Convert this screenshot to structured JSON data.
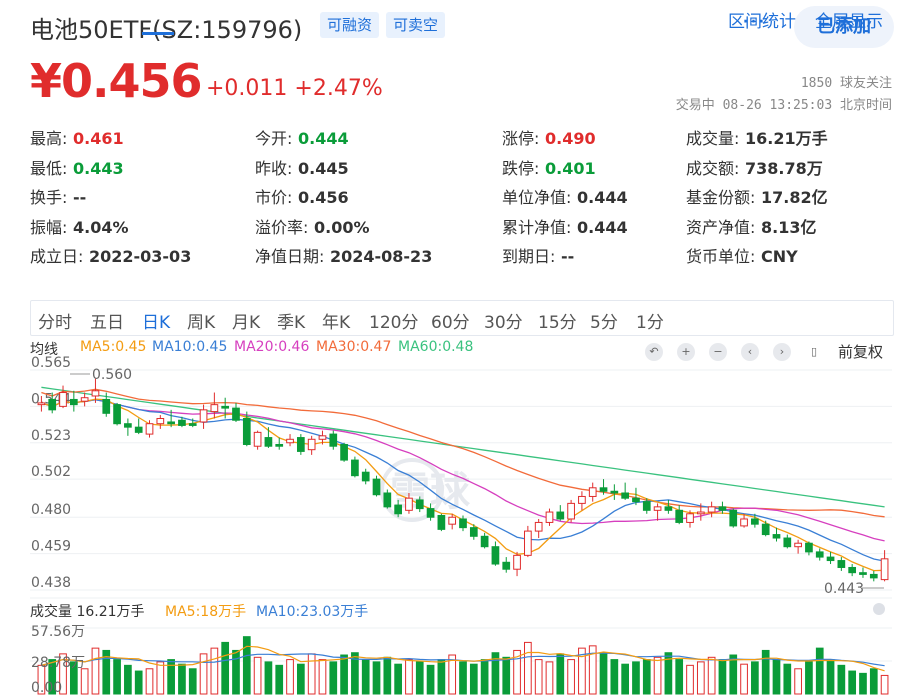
{
  "header": {
    "title": "电池50ETF(SZ:159796)",
    "tag1": "可融资",
    "tag2": "可卖空",
    "more": "···",
    "added": "已添加",
    "price": "¥0.456",
    "change": "+0.011 +2.47%",
    "followers": "1850 球友关注",
    "trade_time": "交易中 08-26 13:25:03 北京时间"
  },
  "quote": [
    [
      {
        "label": "最高:",
        "value": "0.461",
        "color": "red"
      },
      {
        "label": "今开:",
        "value": "0.444",
        "color": "green"
      },
      {
        "label": "涨停:",
        "value": "0.490",
        "color": "red"
      },
      {
        "label": "成交量:",
        "value": "16.21万手",
        "color": ""
      }
    ],
    [
      {
        "label": "最低:",
        "value": "0.443",
        "color": "green"
      },
      {
        "label": "昨收:",
        "value": "0.445",
        "color": ""
      },
      {
        "label": "跌停:",
        "value": "0.401",
        "color": "green"
      },
      {
        "label": "成交额:",
        "value": "738.78万",
        "color": ""
      }
    ],
    [
      {
        "label": "换手:",
        "value": "--",
        "color": ""
      },
      {
        "label": "市价:",
        "value": "0.456",
        "color": ""
      },
      {
        "label": "单位净值:",
        "value": "0.444",
        "color": ""
      },
      {
        "label": "基金份额:",
        "value": "17.82亿",
        "color": ""
      }
    ],
    [
      {
        "label": "振幅:",
        "value": "4.04%",
        "color": ""
      },
      {
        "label": "溢价率:",
        "value": "0.00%",
        "color": ""
      },
      {
        "label": "累计净值:",
        "value": "0.444",
        "color": ""
      },
      {
        "label": "资产净值:",
        "value": "8.13亿",
        "color": ""
      }
    ],
    [
      {
        "label": "成立日:",
        "value": "2022-03-03",
        "color": ""
      },
      {
        "label": "净值日期:",
        "value": "2024-08-23",
        "color": ""
      },
      {
        "label": "到期日:",
        "value": "--",
        "color": ""
      },
      {
        "label": "货币单位:",
        "value": "CNY",
        "color": ""
      }
    ]
  ],
  "tabs": [
    "分时",
    "五日",
    "日K",
    "周K",
    "月K",
    "季K",
    "年K",
    "120分",
    "60分",
    "30分",
    "15分",
    "5分",
    "1分"
  ],
  "active_tab": "日K",
  "tab_right": [
    "区间统计",
    "全屏显示"
  ],
  "ma_legend": {
    "label": "均线",
    "ma5": "MA5:0.45",
    "ma10": "MA10:0.45",
    "ma20": "MA20:0.46",
    "ma30": "MA30:0.47",
    "ma60": "MA60:0.48"
  },
  "controls": [
    "↶",
    "+",
    "−",
    "‹",
    "›",
    "▯"
  ],
  "restore": "前复权",
  "vol_legend": {
    "label": "成交量 16.21万手",
    "ma5": "MA5:18万手",
    "ma10": "MA10:23.03万手"
  },
  "colors": {
    "up": "#e02c2c",
    "down": "#0a9c39",
    "ma5": "#f39c12",
    "ma10": "#3a7fd5",
    "ma20": "#d63fbf",
    "ma30": "#f26b3a",
    "ma60": "#3ac27f",
    "accent": "#1e6fd9"
  },
  "watermark": "雪球",
  "chart_data": {
    "type": "candlestick",
    "y_ticks": [
      "0.565",
      "0.544",
      "0.523",
      "0.502",
      "0.480",
      "0.459",
      "0.438"
    ],
    "ylim": [
      0.438,
      0.565
    ],
    "high_marker": "0.560",
    "low_marker": "0.443",
    "vol_ticks": [
      "57.56万",
      "28.78万",
      "0.00"
    ],
    "vol_max": 57.56,
    "ohlc": [
      [
        0.545,
        0.55,
        0.541,
        0.546
      ],
      [
        0.548,
        0.552,
        0.54,
        0.542
      ],
      [
        0.544,
        0.556,
        0.543,
        0.552
      ],
      [
        0.548,
        0.553,
        0.541,
        0.545
      ],
      [
        0.547,
        0.552,
        0.544,
        0.549
      ],
      [
        0.55,
        0.56,
        0.546,
        0.553
      ],
      [
        0.548,
        0.552,
        0.538,
        0.54
      ],
      [
        0.545,
        0.546,
        0.533,
        0.534
      ],
      [
        0.534,
        0.537,
        0.527,
        0.532
      ],
      [
        0.532,
        0.537,
        0.528,
        0.529
      ],
      [
        0.528,
        0.536,
        0.526,
        0.534
      ],
      [
        0.534,
        0.539,
        0.531,
        0.537
      ],
      [
        0.535,
        0.542,
        0.532,
        0.534
      ],
      [
        0.536,
        0.538,
        0.532,
        0.533
      ],
      [
        0.534,
        0.537,
        0.532,
        0.533
      ],
      [
        0.535,
        0.545,
        0.531,
        0.542
      ],
      [
        0.541,
        0.552,
        0.537,
        0.545
      ],
      [
        0.544,
        0.549,
        0.537,
        0.543
      ],
      [
        0.543,
        0.546,
        0.535,
        0.536
      ],
      [
        0.537,
        0.541,
        0.521,
        0.522
      ],
      [
        0.521,
        0.53,
        0.519,
        0.529
      ],
      [
        0.526,
        0.532,
        0.52,
        0.521
      ],
      [
        0.522,
        0.526,
        0.519,
        0.521
      ],
      [
        0.523,
        0.528,
        0.521,
        0.525
      ],
      [
        0.526,
        0.528,
        0.516,
        0.518
      ],
      [
        0.519,
        0.527,
        0.516,
        0.525
      ],
      [
        0.525,
        0.53,
        0.522,
        0.527
      ],
      [
        0.528,
        0.53,
        0.519,
        0.521
      ],
      [
        0.522,
        0.523,
        0.512,
        0.513
      ],
      [
        0.513,
        0.515,
        0.503,
        0.504
      ],
      [
        0.506,
        0.508,
        0.499,
        0.501
      ],
      [
        0.502,
        0.504,
        0.492,
        0.493
      ],
      [
        0.494,
        0.496,
        0.485,
        0.486
      ],
      [
        0.487,
        0.49,
        0.48,
        0.482
      ],
      [
        0.484,
        0.494,
        0.482,
        0.491
      ],
      [
        0.49,
        0.492,
        0.483,
        0.485
      ],
      [
        0.485,
        0.488,
        0.478,
        0.48
      ],
      [
        0.481,
        0.482,
        0.472,
        0.473
      ],
      [
        0.476,
        0.482,
        0.473,
        0.48
      ],
      [
        0.479,
        0.481,
        0.472,
        0.474
      ],
      [
        0.474,
        0.476,
        0.467,
        0.469
      ],
      [
        0.469,
        0.471,
        0.462,
        0.463
      ],
      [
        0.463,
        0.466,
        0.452,
        0.453
      ],
      [
        0.454,
        0.457,
        0.448,
        0.45
      ],
      [
        0.45,
        0.46,
        0.446,
        0.458
      ],
      [
        0.458,
        0.475,
        0.457,
        0.472
      ],
      [
        0.472,
        0.479,
        0.468,
        0.477
      ],
      [
        0.477,
        0.485,
        0.475,
        0.483
      ],
      [
        0.483,
        0.487,
        0.478,
        0.479
      ],
      [
        0.479,
        0.49,
        0.477,
        0.488
      ],
      [
        0.488,
        0.495,
        0.484,
        0.492
      ],
      [
        0.492,
        0.5,
        0.489,
        0.497
      ],
      [
        0.497,
        0.502,
        0.493,
        0.495
      ],
      [
        0.495,
        0.499,
        0.49,
        0.494
      ],
      [
        0.494,
        0.5,
        0.49,
        0.491
      ],
      [
        0.491,
        0.497,
        0.487,
        0.489
      ],
      [
        0.489,
        0.491,
        0.482,
        0.484
      ],
      [
        0.484,
        0.488,
        0.478,
        0.486
      ],
      [
        0.486,
        0.49,
        0.482,
        0.484
      ],
      [
        0.484,
        0.487,
        0.476,
        0.477
      ],
      [
        0.477,
        0.484,
        0.474,
        0.482
      ],
      [
        0.482,
        0.488,
        0.478,
        0.483
      ],
      [
        0.483,
        0.489,
        0.48,
        0.486
      ],
      [
        0.486,
        0.489,
        0.482,
        0.484
      ],
      [
        0.484,
        0.485,
        0.474,
        0.475
      ],
      [
        0.475,
        0.482,
        0.474,
        0.479
      ],
      [
        0.479,
        0.482,
        0.474,
        0.476
      ],
      [
        0.476,
        0.478,
        0.469,
        0.47
      ],
      [
        0.47,
        0.474,
        0.466,
        0.468
      ],
      [
        0.468,
        0.47,
        0.462,
        0.463
      ],
      [
        0.463,
        0.467,
        0.459,
        0.465
      ],
      [
        0.465,
        0.466,
        0.458,
        0.46
      ],
      [
        0.46,
        0.462,
        0.455,
        0.457
      ],
      [
        0.457,
        0.46,
        0.453,
        0.455
      ],
      [
        0.455,
        0.457,
        0.449,
        0.451
      ],
      [
        0.451,
        0.453,
        0.446,
        0.448
      ],
      [
        0.448,
        0.451,
        0.445,
        0.447
      ],
      [
        0.447,
        0.449,
        0.443,
        0.445
      ],
      [
        0.444,
        0.461,
        0.443,
        0.456
      ]
    ],
    "volume": [
      25,
      30,
      35,
      28,
      22,
      40,
      38,
      30,
      25,
      20,
      22,
      28,
      30,
      26,
      22,
      35,
      40,
      45,
      38,
      50,
      32,
      28,
      25,
      30,
      26,
      35,
      30,
      28,
      34,
      36,
      30,
      28,
      32,
      26,
      30,
      28,
      25,
      30,
      34,
      28,
      26,
      30,
      36,
      32,
      38,
      45,
      30,
      28,
      35,
      30,
      40,
      42,
      36,
      30,
      26,
      28,
      30,
      32,
      36,
      30,
      25,
      28,
      32,
      30,
      34,
      26,
      28,
      38,
      30,
      26,
      22,
      28,
      40,
      30,
      25,
      20,
      18,
      22,
      16.2
    ]
  }
}
